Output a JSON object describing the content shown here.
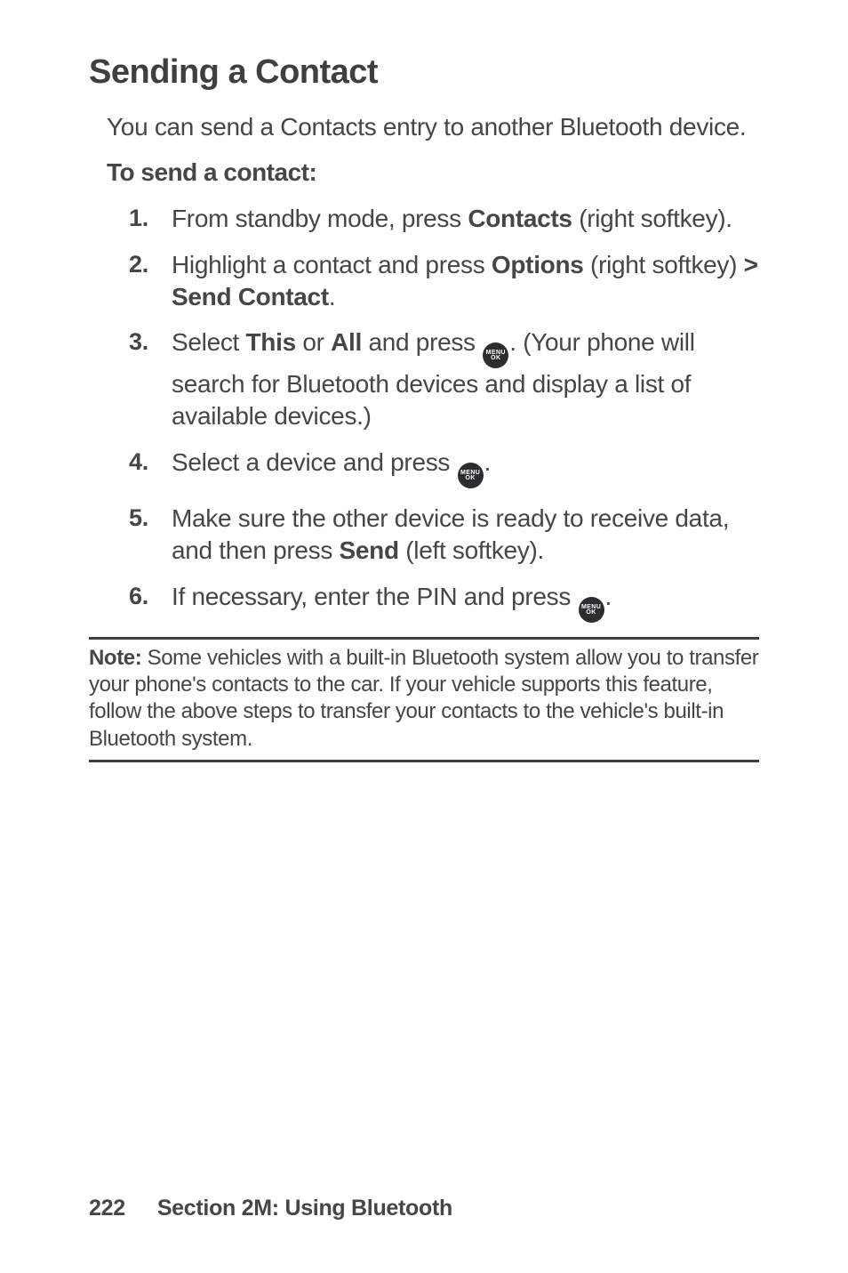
{
  "heading": "Sending a Contact",
  "intro": "You can send a Contacts entry to another Bluetooth device.",
  "subhead": "To send a contact:",
  "icon_menu_line1": "MENU",
  "icon_menu_line2": "OK",
  "steps": [
    {
      "num": "1.",
      "pre": "From standby mode, press ",
      "b1": "Contacts",
      "post": " (right softkey)."
    },
    {
      "num": "2.",
      "pre": "Highlight a contact and press ",
      "b1": "Options",
      "mid": " (right softkey) ",
      "b2": "> Send Contact",
      "post": "."
    },
    {
      "num": "3.",
      "pre": "Select ",
      "b1": "This",
      "mid": " or ",
      "b2": "All",
      "mid2": " and press ",
      "post": ". (Your phone will search for Bluetooth devices and display a list of available devices.)"
    },
    {
      "num": "4.",
      "pre": "Select a device and press ",
      "post": "."
    },
    {
      "num": "5.",
      "pre": "Make sure the other device is ready to receive data, and then press ",
      "b1": "Send",
      "post": " (left softkey)."
    },
    {
      "num": "6.",
      "pre": "If necessary, enter the PIN and press ",
      "post": "."
    }
  ],
  "note": {
    "label": "Note:",
    "text": " Some vehicles with a built-in Bluetooth system allow you to transfer your phone's contacts to the car. If your vehicle supports this feature, follow the above steps to transfer your contacts to the vehicle's built-in Bluetooth system."
  },
  "footer": {
    "page": "222",
    "section": "Section 2M: Using Bluetooth"
  }
}
